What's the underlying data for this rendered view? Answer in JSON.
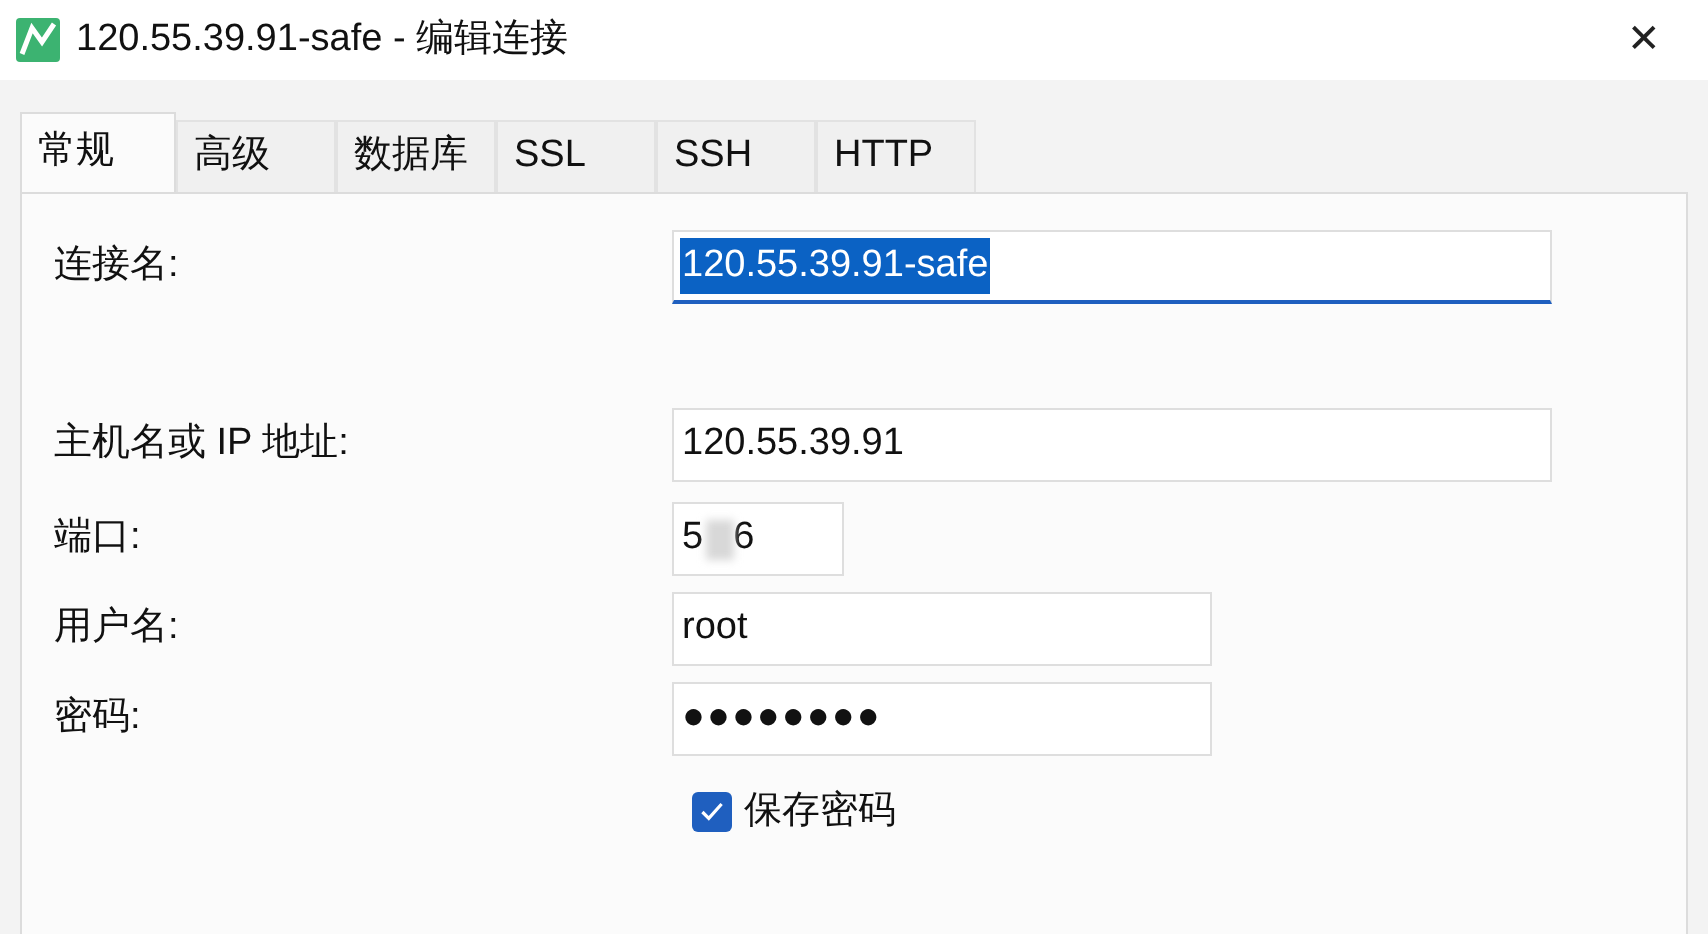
{
  "window": {
    "title": "120.55.39.91-safe - 编辑连接",
    "close": "✕"
  },
  "tabs": [
    {
      "label": "常规",
      "selected": true
    },
    {
      "label": "高级",
      "selected": false
    },
    {
      "label": "数据库",
      "selected": false
    },
    {
      "label": "SSL",
      "selected": false
    },
    {
      "label": "SSH",
      "selected": false
    },
    {
      "label": "HTTP",
      "selected": false
    }
  ],
  "form": [
    {
      "kind": "name",
      "label": "连接名:",
      "value": "120.55.39.91-safe",
      "focused": true,
      "text_selected": true
    },
    {
      "kind": "host",
      "label": "主机名或 IP 地址:",
      "value": "120.55.39.91",
      "focused": false,
      "text_selected": false
    },
    {
      "kind": "port",
      "label": "端口:",
      "value": "5",
      "value_end": "6",
      "focused": false,
      "text_selected": false
    },
    {
      "kind": "user",
      "label": "用户名:",
      "value": "root",
      "focused": false,
      "text_selected": false
    },
    {
      "kind": "password",
      "label": "密码:",
      "value": "●●●●●●●●",
      "focused": false,
      "text_selected": false
    }
  ],
  "save_password": {
    "label": "保存密码",
    "checked": true
  }
}
